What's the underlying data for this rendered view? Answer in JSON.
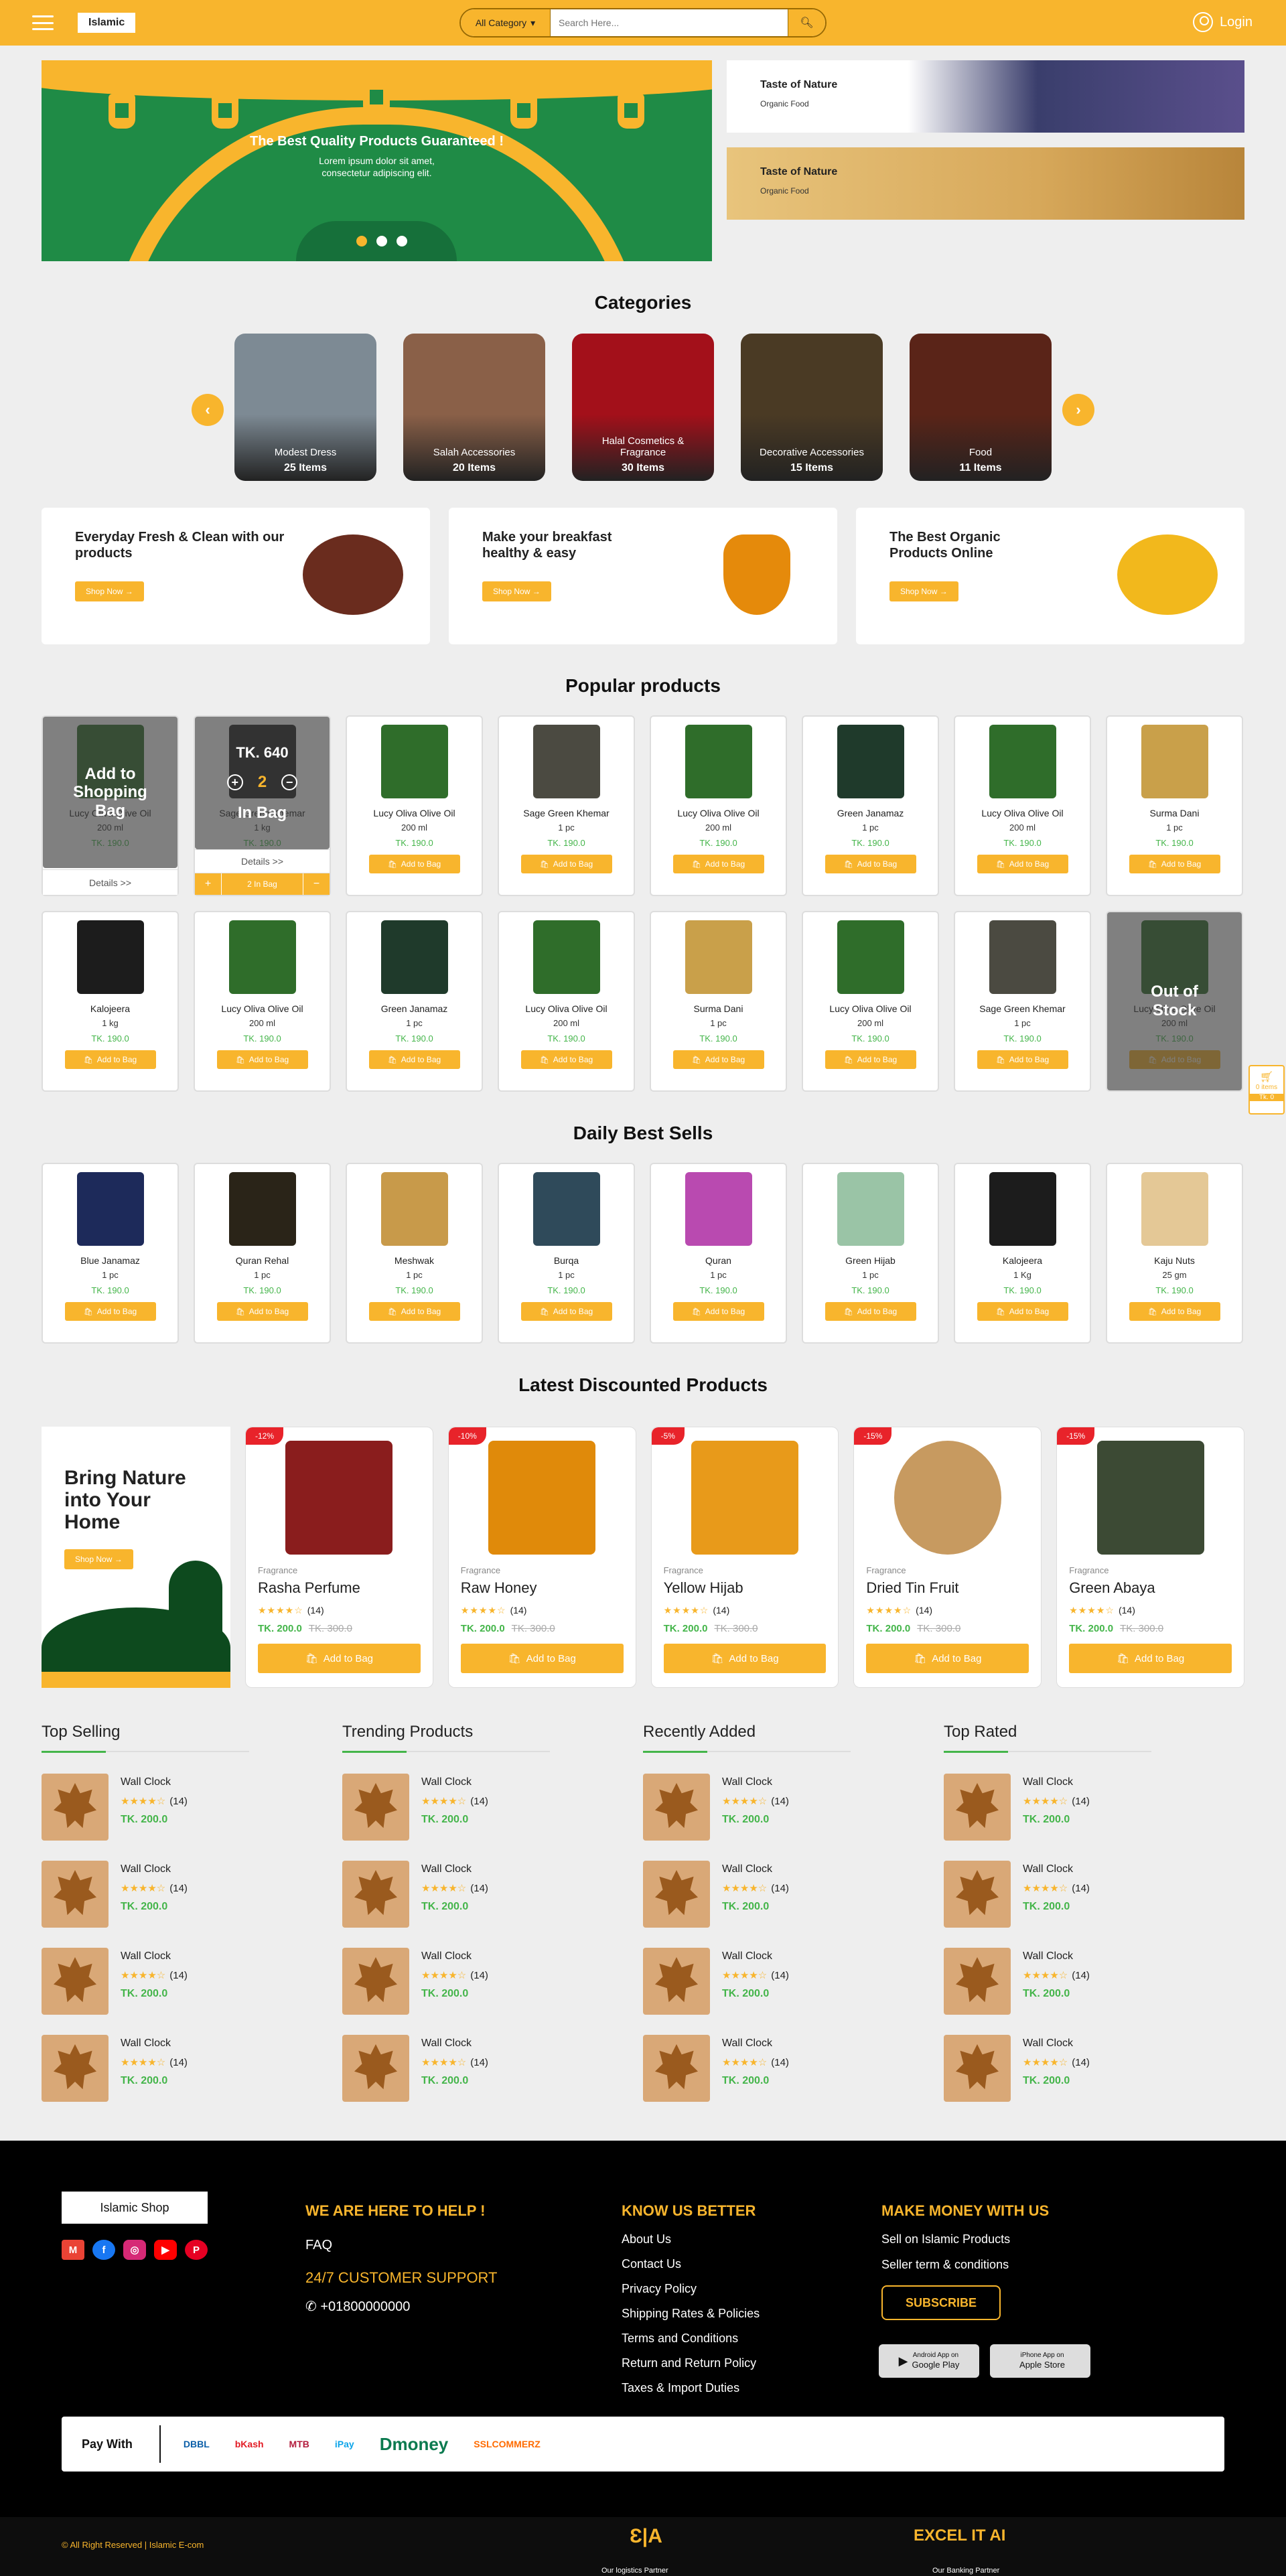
{
  "header": {
    "logo": "Islamic",
    "category_label": "All Category",
    "search_placeholder": "Search Here...",
    "login": "Login"
  },
  "hero": {
    "title": "The Best Quality Products Guaranteed !",
    "subtitle": "Lorem ipsum dolor sit amet,",
    "subtitle2": "consectetur adipiscing elit.",
    "side": [
      {
        "title": "Taste of Nature",
        "sub": "Organic Food"
      },
      {
        "title": "Taste of Nature",
        "sub": "Organic Food"
      }
    ]
  },
  "categories": {
    "heading": "Categories",
    "items": [
      {
        "name": "Modest Dress",
        "count": "25 Items",
        "color": "#7d8a94"
      },
      {
        "name": "Salah Accessories",
        "count": "20 Items",
        "color": "#8a6048"
      },
      {
        "name": "Halal Cosmetics & Fragrance",
        "count": "30 Items",
        "color": "#a3101a"
      },
      {
        "name": "Decorative Accessories",
        "count": "15 Items",
        "color": "#4a3a24"
      },
      {
        "name": "Food",
        "count": "11 Items",
        "color": "#5a2418"
      }
    ]
  },
  "promos": [
    {
      "title": "Everyday Fresh & Clean with our products",
      "btn": "Shop Now",
      "img": "#6a2c1e"
    },
    {
      "title": "Make your breakfast healthy & easy",
      "btn": "Shop Now",
      "img": "#e58a0b"
    },
    {
      "title": "The Best Organic Products Online",
      "btn": "Shop Now",
      "img": "#f2b81c"
    }
  ],
  "popular": {
    "heading": "Popular products",
    "overlay_add": "Add to Shopping Bag",
    "details": "Details >>",
    "overlay_price": "TK. 640",
    "overlay_qty": "2",
    "overlay_inbag": "In Bag",
    "inbag_btn": "2 In Bag",
    "out_of_stock": "Out of Stock",
    "add_label": "Add to Bag",
    "items": [
      {
        "name": "Lucy Oliva Olive Oil",
        "unit": "200 ml",
        "price": "TK. 190.0",
        "color": "#2f6d2a"
      },
      {
        "name": "Sage Green Khemar",
        "unit": "1 kg",
        "price": "TK. 190.0",
        "color": "#222"
      },
      {
        "name": "Lucy Oliva Olive Oil",
        "unit": "200 ml",
        "price": "TK. 190.0",
        "color": "#2f6d2a"
      },
      {
        "name": "Sage Green Khemar",
        "unit": "1 pc",
        "price": "TK. 190.0",
        "color": "#4b4a41"
      },
      {
        "name": "Lucy Oliva Olive Oil",
        "unit": "200 ml",
        "price": "TK. 190.0",
        "color": "#2f6d2a"
      },
      {
        "name": "Green Janamaz",
        "unit": "1 pc",
        "price": "TK. 190.0",
        "color": "#1f3a2b"
      },
      {
        "name": "Lucy Oliva Olive Oil",
        "unit": "200 ml",
        "price": "TK. 190.0",
        "color": "#2f6d2a"
      },
      {
        "name": "Surma Dani",
        "unit": "1 pc",
        "price": "TK. 190.0",
        "color": "#c9a04a"
      },
      {
        "name": "Kalojeera",
        "unit": "1 kg",
        "price": "TK. 190.0",
        "color": "#1c1c1c"
      },
      {
        "name": "Lucy Oliva Olive Oil",
        "unit": "200 ml",
        "price": "TK. 190.0",
        "color": "#2f6d2a"
      },
      {
        "name": "Green Janamaz",
        "unit": "1 pc",
        "price": "TK. 190.0",
        "color": "#1f3a2b"
      },
      {
        "name": "Lucy Oliva Olive Oil",
        "unit": "200 ml",
        "price": "TK. 190.0",
        "color": "#2f6d2a"
      },
      {
        "name": "Surma Dani",
        "unit": "1 pc",
        "price": "TK. 190.0",
        "color": "#c9a04a"
      },
      {
        "name": "Lucy Oliva Olive Oil",
        "unit": "200 ml",
        "price": "TK. 190.0",
        "color": "#2f6d2a"
      },
      {
        "name": "Sage Green Khemar",
        "unit": "1 pc",
        "price": "TK. 190.0",
        "color": "#4b4a41"
      },
      {
        "name": "Lucy Oliva Olive Oil",
        "unit": "200 ml",
        "price": "TK. 190.0",
        "color": "#2f6d2a"
      }
    ]
  },
  "daily": {
    "heading": "Daily Best Sells",
    "items": [
      {
        "name": "Blue Janamaz",
        "unit": "1 pc",
        "price": "TK. 190.0",
        "color": "#1d2a5a"
      },
      {
        "name": "Quran Rehal",
        "unit": "1 pc",
        "price": "TK. 190.0",
        "color": "#2a2418"
      },
      {
        "name": "Meshwak",
        "unit": "1 pc",
        "price": "TK. 190.0",
        "color": "#c89a4a"
      },
      {
        "name": "Burqa",
        "unit": "1 pc",
        "price": "TK. 190.0",
        "color": "#2f4a5a"
      },
      {
        "name": "Quran",
        "unit": "1 pc",
        "price": "TK. 190.0",
        "color": "#b94ab0"
      },
      {
        "name": "Green Hijab",
        "unit": "1 pc",
        "price": "TK. 190.0",
        "color": "#9ac4a6"
      },
      {
        "name": "Kalojeera",
        "unit": "1 Kg",
        "price": "TK. 190.0",
        "color": "#1c1c1c"
      },
      {
        "name": "Kaju Nuts",
        "unit": "25 gm",
        "price": "TK. 190.0",
        "color": "#e4c896"
      }
    ]
  },
  "discounted": {
    "heading": "Latest Discounted Products",
    "banner_title": "Bring Nature into Your Home",
    "banner_btn": "Shop Now",
    "add_label": "Add to Bag",
    "items": [
      {
        "badge": "-12%",
        "cat": "Fragrance",
        "name": "Rasha Perfume",
        "reviews": "(14)",
        "price": "TK. 200.0",
        "old": "TK. 300.0",
        "rating": 4,
        "color": "#8a1d1d"
      },
      {
        "badge": "-10%",
        "cat": "Fragrance",
        "name": "Raw Honey",
        "reviews": "(14)",
        "price": "TK. 200.0",
        "old": "TK. 300.0",
        "rating": 4,
        "color": "#e08a0a"
      },
      {
        "badge": "-5%",
        "cat": "Fragrance",
        "name": "Yellow Hijab",
        "reviews": "(14)",
        "price": "TK. 200.0",
        "old": "TK. 300.0",
        "rating": 4,
        "color": "#e89a1a"
      },
      {
        "badge": "-15%",
        "cat": "Fragrance",
        "name": "Dried Tin Fruit",
        "reviews": "(14)",
        "price": "TK. 200.0",
        "old": "TK. 300.0",
        "rating": 4,
        "color": "#c79a60"
      },
      {
        "badge": "-15%",
        "cat": "Fragrance",
        "name": "Green Abaya",
        "reviews": "(14)",
        "price": "TK. 200.0",
        "old": "TK. 300.0",
        "rating": 4,
        "color": "#3c4a34"
      }
    ]
  },
  "lists": [
    {
      "title": "Top Selling"
    },
    {
      "title": "Trending Products"
    },
    {
      "title": "Recently Added"
    },
    {
      "title": "Top Rated"
    }
  ],
  "list_item": {
    "name": "Wall Clock",
    "reviews": "(14)",
    "price": "TK. 200.0",
    "rating": 4
  },
  "footer": {
    "brand": "Islamic Shop",
    "help_title": "WE ARE HERE TO HELP !",
    "faq": "FAQ",
    "support": "24/7 CUSTOMER SUPPORT",
    "phone": "+01800000000",
    "know_title": "KNOW US BETTER",
    "know_links": [
      "About Us",
      "Contact Us",
      "Privacy Policy",
      "Shipping Rates & Policies",
      "Terms and Conditions",
      "Return and Return Policy",
      "Taxes & Import Duties"
    ],
    "money_title": "MAKE MONEY WITH US",
    "money_links": [
      "Sell on Islamic Products",
      "Seller term & conditions"
    ],
    "subscribe": "SUBSCRIBE",
    "google_top": "Android App on",
    "google_label": "Google Play",
    "apple_top": "iPhone App on",
    "apple_label": "Apple Store",
    "pay_with": "Pay With",
    "pay_logos": [
      "DBBL",
      "bKash",
      "MTB",
      "iPay",
      "Dmoney",
      "SSLCOMMERZ"
    ],
    "copyright": "All Right Reserved | Islamic E-com",
    "logistics": "Our logistics Partner",
    "banking": "Our Banking Partner",
    "partner_name": "EXCEL IT AI"
  },
  "float_cart": {
    "items": "0 items",
    "total": "Tk. 0"
  }
}
